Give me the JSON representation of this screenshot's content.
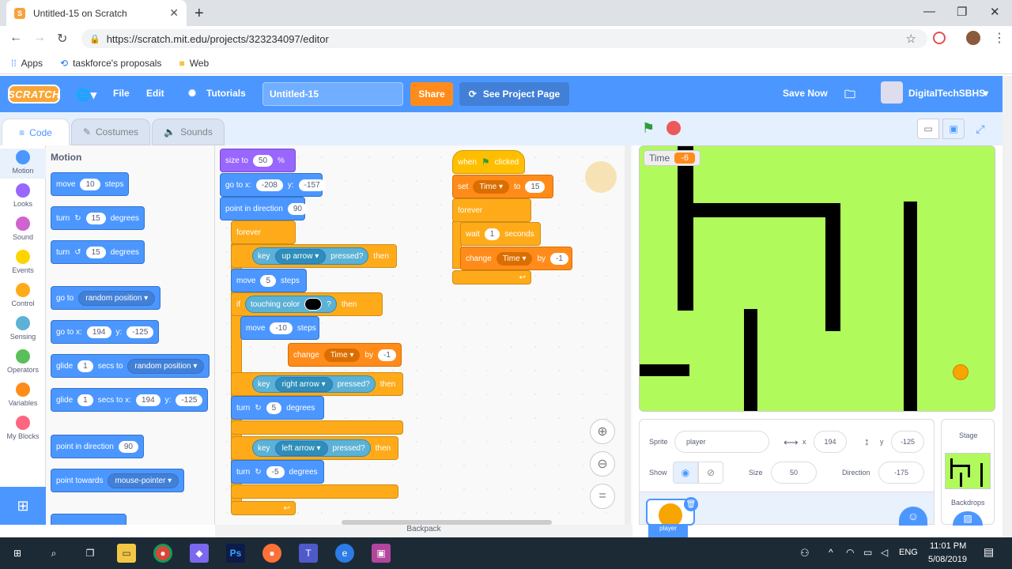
{
  "browser": {
    "tab_title": "Untitled-15 on Scratch",
    "url": "https://scratch.mit.edu/projects/323234097/editor",
    "bookmarks": [
      "Apps",
      "taskforce's proposals",
      "Web"
    ]
  },
  "menubar": {
    "logo": "SCRATCH",
    "file": "File",
    "edit": "Edit",
    "tutorials": "Tutorials",
    "project_title": "Untitled-15",
    "share": "Share",
    "see_project": "See Project Page",
    "save_now": "Save Now",
    "username": "DigitalTechSBHS"
  },
  "editor_tabs": {
    "code": "Code",
    "costumes": "Costumes",
    "sounds": "Sounds"
  },
  "categories": [
    {
      "label": "Motion",
      "color": "#4c97ff"
    },
    {
      "label": "Looks",
      "color": "#9966ff"
    },
    {
      "label": "Sound",
      "color": "#cf63cf"
    },
    {
      "label": "Events",
      "color": "#ffd500"
    },
    {
      "label": "Control",
      "color": "#ffab19"
    },
    {
      "label": "Sensing",
      "color": "#5cb1d6"
    },
    {
      "label": "Operators",
      "color": "#59c059"
    },
    {
      "label": "Variables",
      "color": "#ff8c1a"
    },
    {
      "label": "My Blocks",
      "color": "#ff6680"
    }
  ],
  "palette": {
    "heading": "Motion",
    "move": {
      "a": "move",
      "v": "10",
      "b": "steps"
    },
    "turn_right": {
      "a": "turn",
      "v": "15",
      "b": "degrees"
    },
    "turn_left": {
      "a": "turn",
      "v": "15",
      "b": "degrees"
    },
    "goto": {
      "a": "go to",
      "d": "random position"
    },
    "goto_xy": {
      "a": "go to x:",
      "x": "194",
      "b": "y:",
      "y": "-125"
    },
    "glide": {
      "a": "glide",
      "v": "1",
      "b": "secs to",
      "d": "random position"
    },
    "glide_xy": {
      "a": "glide",
      "v": "1",
      "b": "secs to x:",
      "x": "194",
      "c": "y:",
      "y": "-125"
    },
    "point_dir": {
      "a": "point in direction",
      "v": "90"
    },
    "point_towards": {
      "a": "point towards",
      "d": "mouse-pointer"
    }
  },
  "script1": {
    "size": {
      "a": "size to",
      "v": "50",
      "b": "%"
    },
    "goto": {
      "a": "go to x:",
      "x": "-208",
      "b": "y:",
      "y": "-157"
    },
    "point": {
      "a": "point in direction",
      "v": "90"
    },
    "forever": "forever",
    "if1": {
      "key": "key",
      "d": "up arrow",
      "b": "pressed?",
      "then": "then"
    },
    "move1": {
      "a": "move",
      "v": "5",
      "b": "steps"
    },
    "if_touch": {
      "if": "if",
      "a": "touching color",
      "q": "?",
      "then": "then"
    },
    "move2": {
      "a": "move",
      "v": "-10",
      "b": "steps"
    },
    "change": {
      "a": "change",
      "d": "Time",
      "b": "by",
      "v": "-1"
    },
    "if2": {
      "key": "key",
      "d": "right arrow",
      "b": "pressed?",
      "then": "then"
    },
    "turn1": {
      "a": "turn",
      "v": "5",
      "b": "degrees"
    },
    "if3": {
      "key": "key",
      "d": "left arrow",
      "b": "pressed?",
      "then": "then"
    },
    "turn2": {
      "a": "turn",
      "v": "-5",
      "b": "degrees"
    }
  },
  "script2": {
    "hat": {
      "a": "when",
      "b": "clicked"
    },
    "set": {
      "a": "set",
      "d": "Time",
      "b": "to",
      "v": "15"
    },
    "forever": "forever",
    "wait": {
      "a": "wait",
      "v": "1",
      "b": "seconds"
    },
    "change": {
      "a": "change",
      "d": "Time",
      "b": "by",
      "v": "-1"
    }
  },
  "stage": {
    "monitor_label": "Time",
    "monitor_value": "-6"
  },
  "sprite_info": {
    "sprite_label": "Sprite",
    "sprite_name": "player",
    "x_label": "x",
    "x": "194",
    "y_label": "y",
    "y": "-125",
    "show_label": "Show",
    "size_label": "Size",
    "size": "50",
    "direction_label": "Direction",
    "direction": "-175",
    "thumb_label": "player"
  },
  "stage_pane": {
    "title": "Stage",
    "backdrops": "Backdrops"
  },
  "backpack": "Backpack",
  "taskbar": {
    "time": "11:01 PM",
    "date": "5/08/2019",
    "lang": "ENG"
  }
}
